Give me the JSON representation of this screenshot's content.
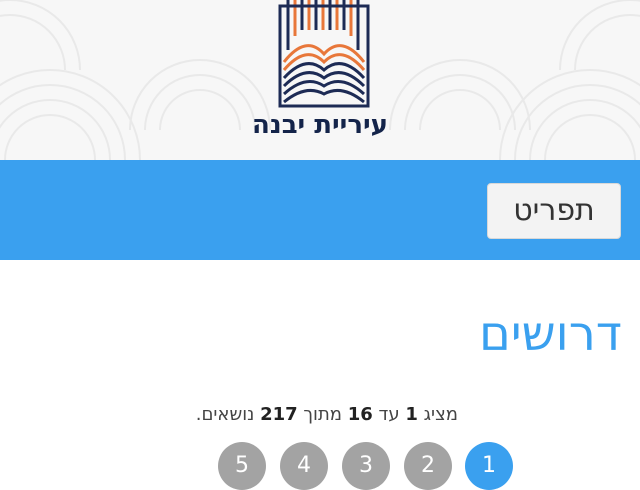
{
  "header": {
    "logo_text": "עיריית יבנה",
    "logo_colors": {
      "navy": "#1d2b55",
      "orange": "#e8773a"
    }
  },
  "toolbar": {
    "color": "#3aa0ef",
    "menu_label": "תפריט"
  },
  "main": {
    "title": "דרושים",
    "summary": {
      "prefix": "מציג",
      "from": "1",
      "to_word": "עד",
      "to": "16",
      "of_word": "מתוך",
      "total": "217",
      "suffix": "נושאים."
    }
  },
  "pagination": {
    "pages": [
      "1",
      "2",
      "3",
      "4",
      "5"
    ],
    "current": "1",
    "active_color": "#3aa0ef",
    "inactive_color": "#a3a3a3"
  }
}
